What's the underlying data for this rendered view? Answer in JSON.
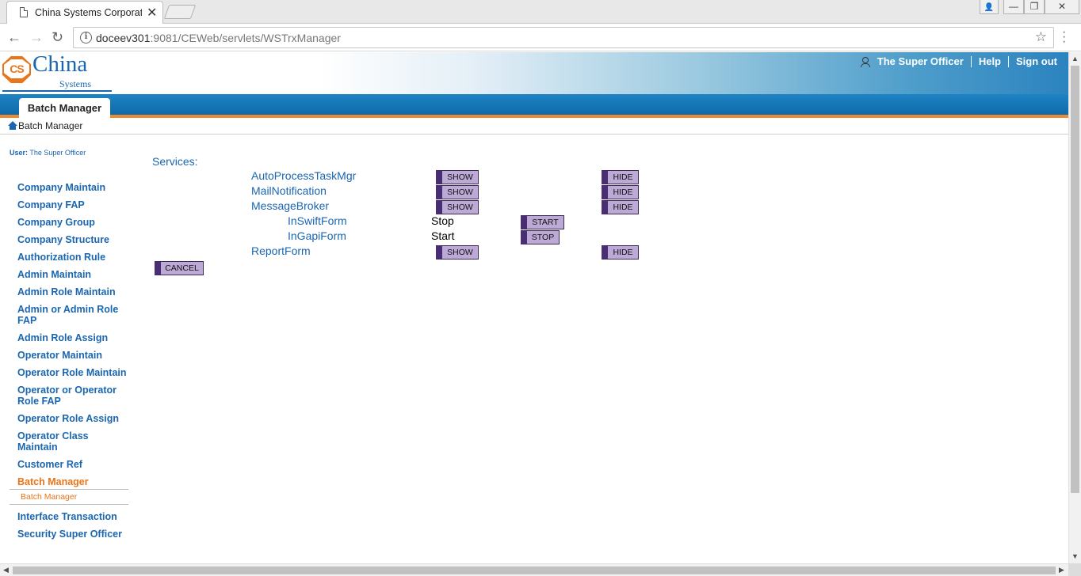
{
  "browser": {
    "tab_title": "China Systems Corporati",
    "tab_close": "✕",
    "url_host": "doceev301",
    "url_path": ":9081/CEWeb/servlets/WSTrxManager",
    "back": "←",
    "forward": "→",
    "reload": "↻",
    "star": "☆",
    "info": "i",
    "win_user": "👤",
    "win_min": "—",
    "win_restore": "❐",
    "win_close": "✕"
  },
  "header": {
    "logo_badge": "CS",
    "logo_name": "China",
    "logo_sub": "Systems",
    "user_name": "The Super Officer",
    "help": "Help",
    "sign_out": "Sign out"
  },
  "nav": {
    "active_tab": "Batch Manager",
    "breadcrumb": "Batch Manager"
  },
  "sidebar": {
    "user_label": "User:",
    "user_value": "The Super Officer",
    "items": [
      "Company Maintain",
      "Company FAP",
      "Company Group",
      "Company Structure",
      "Authorization Rule",
      "Admin Maintain",
      "Admin Role Maintain",
      "Admin or Admin Role FAP",
      "Admin Role Assign",
      "Operator Maintain",
      "Operator Role Maintain",
      "Operator or Operator Role FAP",
      "Operator Role Assign",
      "Operator Class Maintain",
      "Customer Ref",
      "Batch Manager",
      "Interface Transaction",
      "Security Super Officer"
    ],
    "active_sub": "Batch Manager"
  },
  "content": {
    "services_label": "Services:",
    "services": [
      {
        "name": "AutoProcessTaskMgr",
        "show": "SHOW",
        "hide": "HIDE"
      },
      {
        "name": "MailNotification",
        "show": "SHOW",
        "hide": "HIDE"
      },
      {
        "name": "MessageBroker",
        "show": "SHOW",
        "hide": "HIDE"
      },
      {
        "name": "InSwiftForm",
        "status": "Stop",
        "action": "START"
      },
      {
        "name": "InGapiForm",
        "status": "Start",
        "action": "STOP"
      },
      {
        "name": "ReportForm",
        "show": "SHOW",
        "hide": "HIDE"
      }
    ],
    "cancel": "CANCEL"
  },
  "scroll": {
    "up": "▲",
    "down": "▼",
    "left": "◀",
    "right": "▶"
  }
}
